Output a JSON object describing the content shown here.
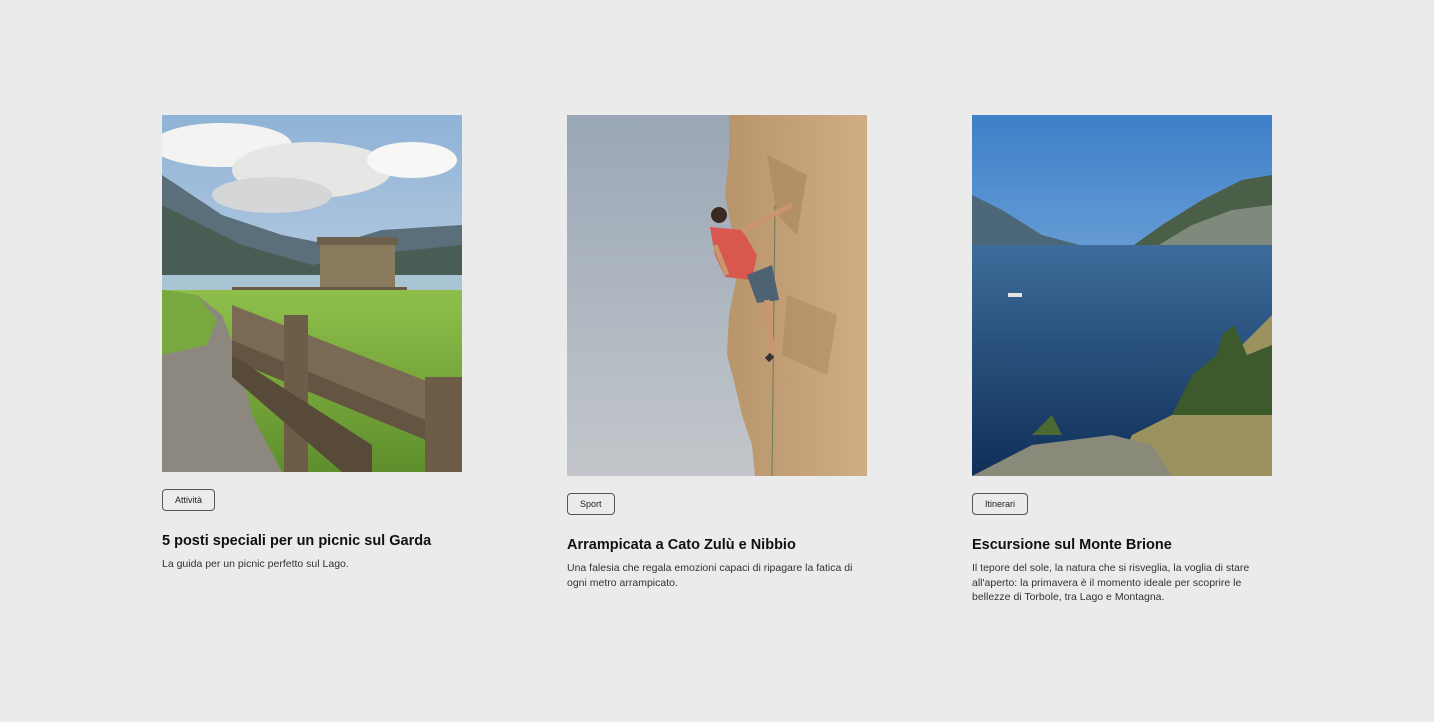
{
  "cards": [
    {
      "tag": "Attività",
      "title": "5 posti speciali per un picnic sul Garda",
      "description": "La guida per un picnic perfetto sul Lago."
    },
    {
      "tag": "Sport",
      "title": "Arrampicata a Cato Zulù e Nibbio",
      "description": "Una falesia che regala emozioni capaci di ripagare la fatica di ogni metro arrampicato."
    },
    {
      "tag": "Itinerari",
      "title": "Escursione sul Monte Brione",
      "description": "Il tepore del sole, la natura che si risveglia, la voglia di stare all'aperto: la primavera è il momento ideale per scoprire le bellezze di Torbole, tra Lago e Montagna."
    }
  ],
  "colors": {
    "background": "#ebebeb",
    "tag_border": "#555555",
    "title": "#111111",
    "description": "#333333"
  }
}
